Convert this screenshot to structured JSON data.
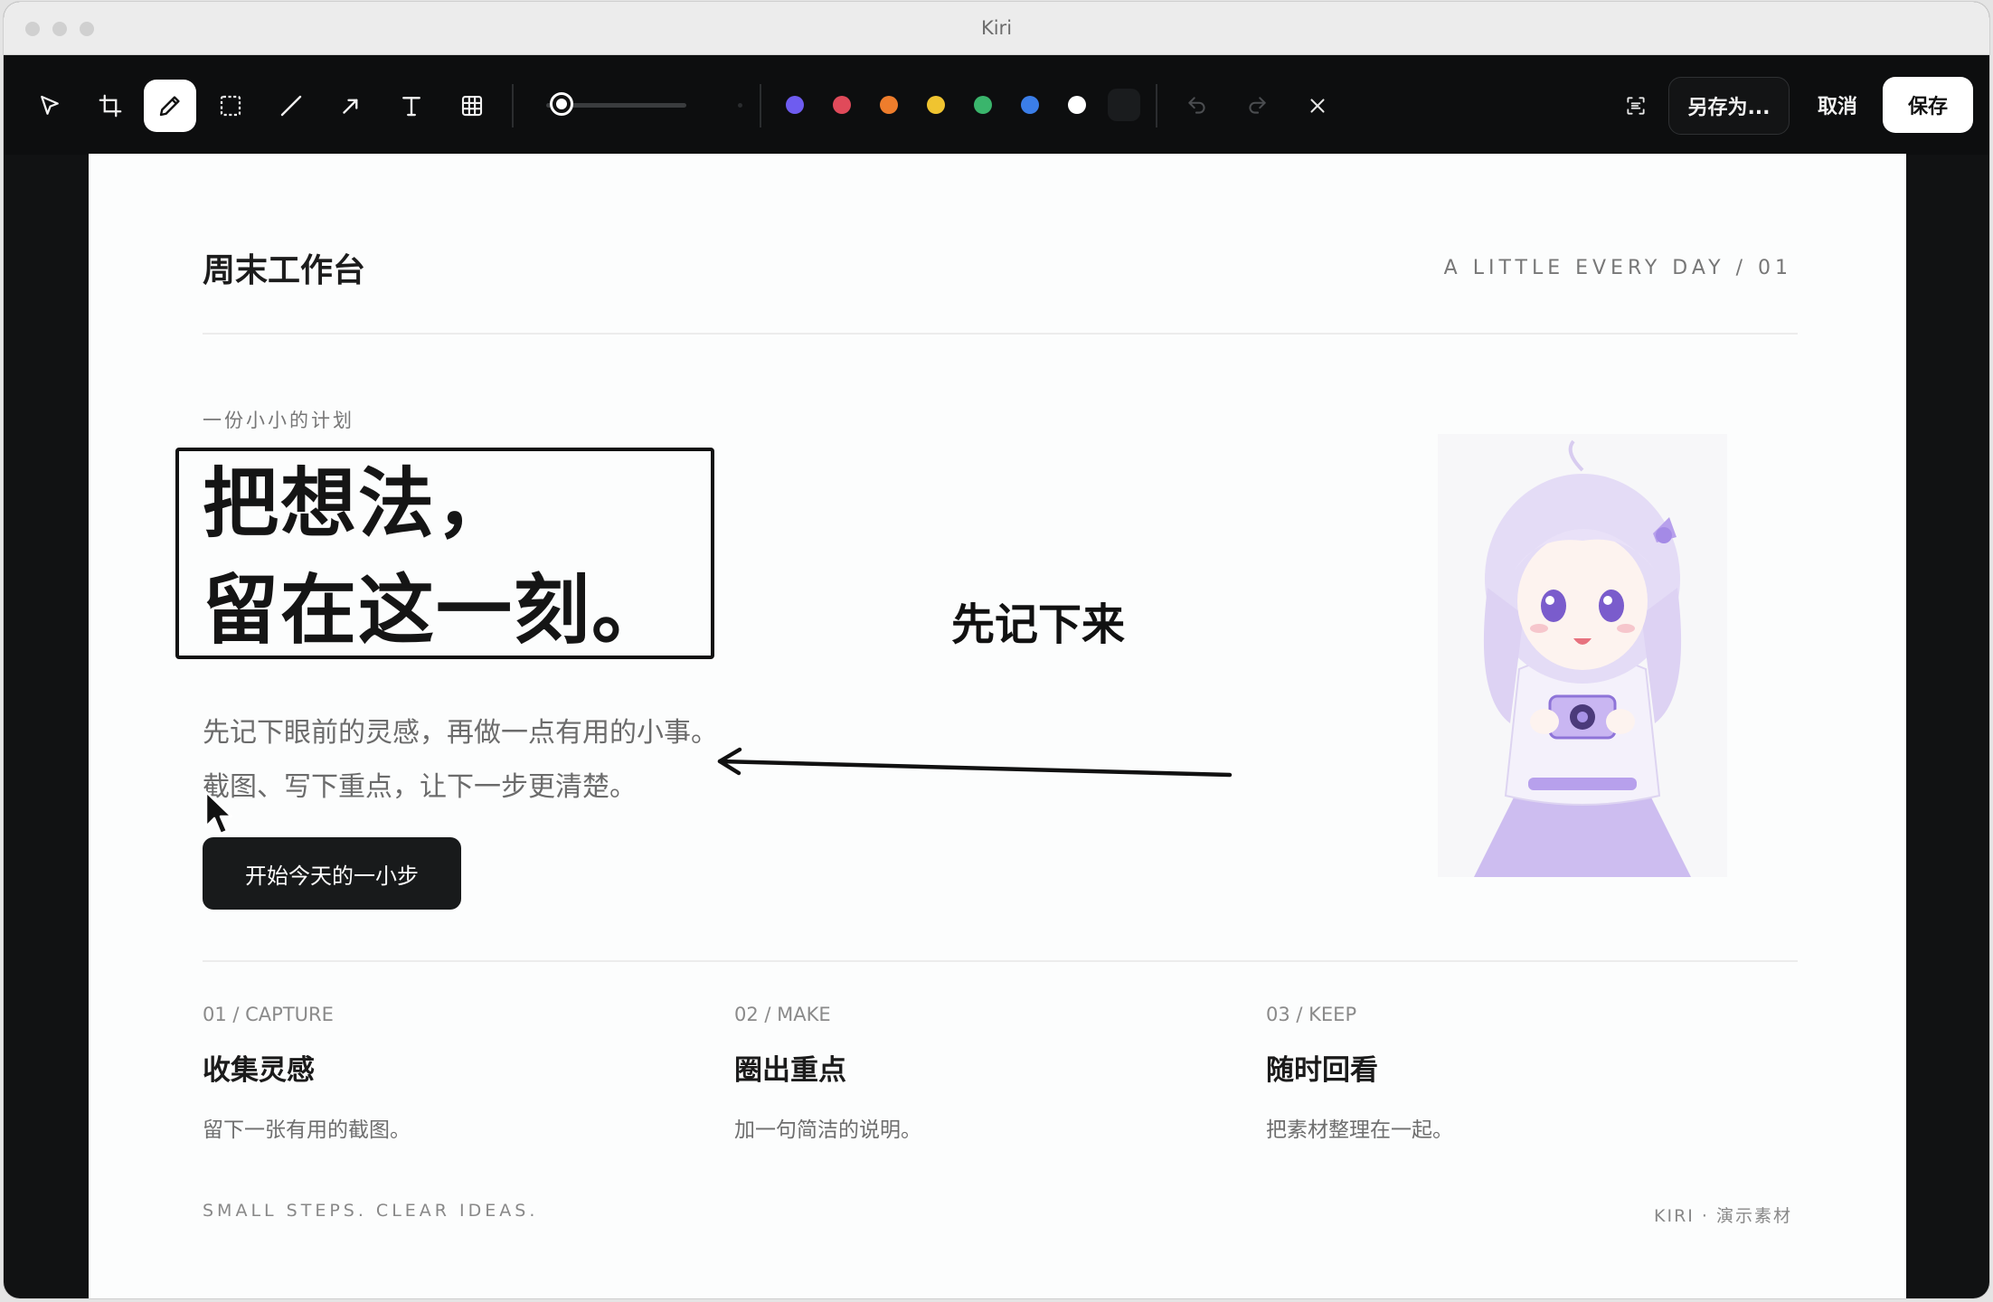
{
  "window": {
    "title": "Kiri"
  },
  "toolbar": {
    "tools": [
      {
        "name": "select-tool",
        "icon": "cursor-icon",
        "active": false
      },
      {
        "name": "crop-tool",
        "icon": "crop-icon",
        "active": false
      },
      {
        "name": "pen-tool",
        "icon": "pencil-icon",
        "active": true
      },
      {
        "name": "rectangle-tool",
        "icon": "dashed-rectangle-icon",
        "active": false
      },
      {
        "name": "line-tool",
        "icon": "line-icon",
        "active": false
      },
      {
        "name": "arrow-tool",
        "icon": "arrow-icon",
        "active": false
      },
      {
        "name": "text-tool",
        "icon": "text-icon",
        "active": false
      },
      {
        "name": "mosaic-tool",
        "icon": "grid-icon",
        "active": false
      }
    ],
    "stroke_size_level": 0.05,
    "colors": [
      "#6e5cf0",
      "#e04a5a",
      "#ee7d2c",
      "#f0c430",
      "#3ab56c",
      "#3b7ee8",
      "#ffffff",
      "#1a1c1e"
    ],
    "selected_color": "#ffffff",
    "ocr_icon": "scan-text-icon",
    "save_as_label": "另存为...",
    "cancel_label": "取消",
    "save_label": "保存"
  },
  "page": {
    "brand": "周末工作台",
    "tagline": "A LITTLE EVERY DAY / 01",
    "eyebrow": "一份小小的计划",
    "hero_line1": "把想法，",
    "hero_line2": "留在这一刻。",
    "annotation_text": "先记下来",
    "paragraph_line1": "先记下眼前的灵感，再做一点有用的小事。",
    "paragraph_line2": "截图、写下重点，让下一步更清楚。",
    "cta_label": "开始今天的一小步",
    "cards": [
      {
        "num": "01 / CAPTURE",
        "title": "收集灵感",
        "desc": "留下一张有用的截图。"
      },
      {
        "num": "02 / MAKE",
        "title": "圈出重点",
        "desc": "加一句简洁的说明。"
      },
      {
        "num": "03 / KEEP",
        "title": "随时回看",
        "desc": "把素材整理在一起。"
      }
    ],
    "footer_left": "SMALL STEPS. CLEAR IDEAS.",
    "footer_right": "KIRI · 演示素材"
  },
  "colors": {
    "toolbar_bg": "#0d0e0f",
    "canvas_bg": "#fcfdfd",
    "accent": "#9a86e0"
  }
}
